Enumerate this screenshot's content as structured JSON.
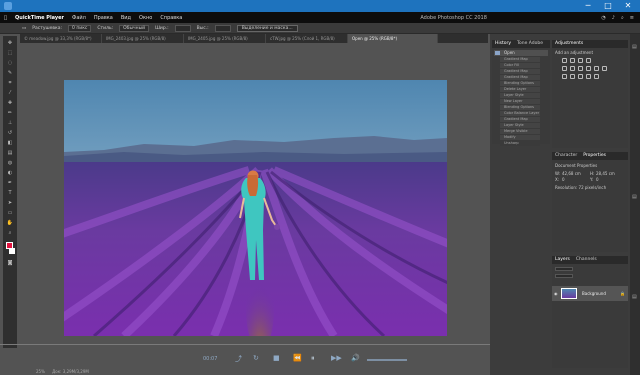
{
  "window": {
    "controls": [
      "─",
      "□",
      "✕"
    ]
  },
  "menubar": {
    "app_name": "QuickTime Player",
    "items": [
      "Файл",
      "Правка",
      "Вид",
      "Окно",
      "Справка"
    ],
    "ps_title": "Adobe Photoshop CC 2018"
  },
  "options_bar": {
    "feather_label": "Растушевка:",
    "feather_value": "0 пикс",
    "style_label": "Стиль:",
    "style_value": "Обычный",
    "width_label": "Шир.:",
    "height_label": "Выс.:",
    "select_mask_button": "Выделение и маска..."
  },
  "doc_tabs": [
    "© meadow.jpg @ 33,3% (RGB/8*)",
    "IMG_2403.jpg @ 25% (RGB/8)",
    "IMG_2405.jpg @ 25% (RGB/8)",
    "cTW.jpg @ 25% (Слой 1, RGB/8)",
    "Open @ 25% (RGB/8*)"
  ],
  "active_tab_index": 4,
  "history_panel": {
    "tabs": [
      "History",
      "Tone Adobe Color"
    ],
    "snapshot": "Open",
    "items": [
      "Gradient Map",
      "Color Fill",
      "Gradient Map",
      "Gradient Map",
      "Blending Options",
      "Delete Layer",
      "Layer Style",
      "New Layer",
      "Blending Options",
      "Color Balance Layer",
      "Gradient Map",
      "Layer Style",
      "Merge Visible",
      "Modify",
      "Unsharp"
    ]
  },
  "adjustments_panel": {
    "title": "Adjustments",
    "subtitle": "Add an adjustment"
  },
  "properties_panel": {
    "tabs": [
      "Character",
      "Properties"
    ],
    "doc_label": "Document Properties",
    "w_label": "W:",
    "w_value": "42,68 cm",
    "h_label": "H:",
    "h_value": "28,45 cm",
    "x_label": "X:",
    "x_value": "0",
    "y_label": "Y:",
    "y_value": "0",
    "resolution": "Resolution: 72 pixels/inch"
  },
  "layers_panel": {
    "tabs": [
      "Layers",
      "Channels"
    ],
    "layer_name": "Background"
  },
  "status": {
    "zoom": "25%",
    "doc": "Док: 3,29M/3,29M"
  },
  "quicktime": {
    "time": "00:07",
    "buttons": [
      "⏪",
      "▶▶",
      "⏮",
      "⏸",
      "⏭",
      "🔊"
    ]
  },
  "colors": {
    "titlebar": "#1e73be",
    "ps_dark": "#2f2f2f",
    "lavender": "#6a3f9e",
    "sky": "#5b8fb7",
    "dress": "#3fc6c0"
  }
}
